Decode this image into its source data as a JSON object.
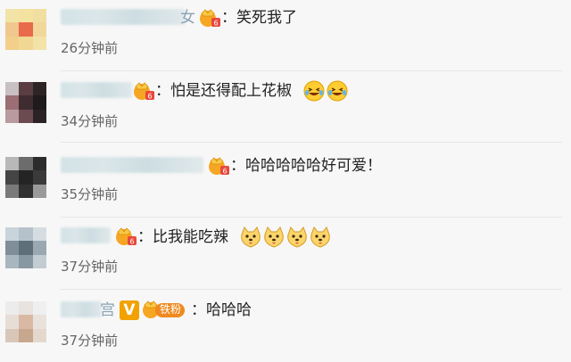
{
  "comments": [
    {
      "name_tail": "女",
      "text": "：笑死我了",
      "time": "26分钟前"
    },
    {
      "name_tail": "",
      "text": "：怕是还得配上花椒",
      "time": "34分钟前"
    },
    {
      "name_tail": "",
      "text": "：哈哈哈哈哈好可爱！",
      "time": "35分钟前"
    },
    {
      "name_tail": "",
      "text": "：比我能吃辣",
      "time": "37分钟前"
    },
    {
      "name_tail": "宫",
      "v_label": "V",
      "fan_label": "铁粉",
      "text": "：哈哈哈",
      "time": "37分钟前"
    }
  ],
  "colors": {
    "background": "#f7f7f7",
    "time_text": "#666666",
    "vip_gold": "#f5a623",
    "v_badge": "#f2a100"
  },
  "icons": {
    "vip": "vip-crown-badge-icon",
    "laugh": "laughing-tears-emoji-icon",
    "dog": "doge-emoji-icon"
  }
}
